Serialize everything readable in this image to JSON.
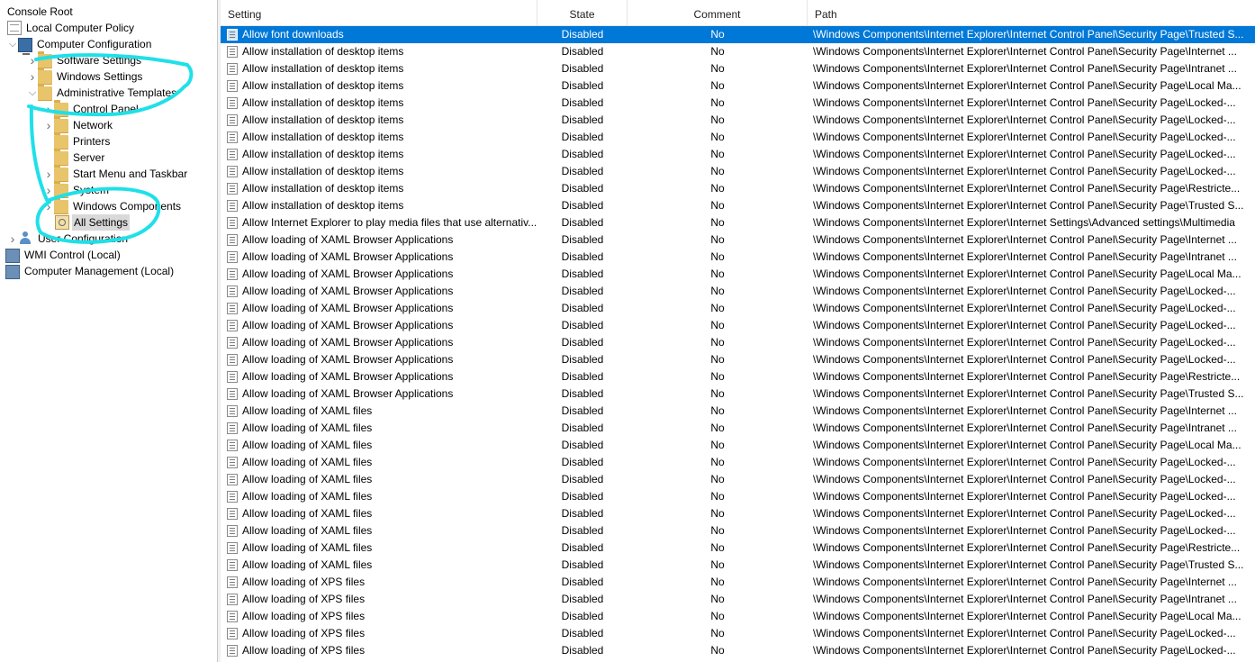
{
  "tree": {
    "items": [
      {
        "label": "Console Root",
        "indent": 0,
        "chevron": "",
        "icon": "none"
      },
      {
        "label": "Local Computer Policy",
        "indent": 0,
        "chevron": "",
        "icon": "doc"
      },
      {
        "label": "Computer Configuration",
        "indent": 1,
        "chevron": "v",
        "icon": "computer"
      },
      {
        "label": "Software Settings",
        "indent": 2,
        "chevron": ">",
        "icon": "folder"
      },
      {
        "label": "Windows Settings",
        "indent": 2,
        "chevron": ">",
        "icon": "folder"
      },
      {
        "label": "Administrative Templates",
        "indent": 2,
        "chevron": "v",
        "icon": "folder"
      },
      {
        "label": "Control Panel",
        "indent": 3,
        "chevron": ">",
        "icon": "folder"
      },
      {
        "label": "Network",
        "indent": 3,
        "chevron": ">",
        "icon": "folder"
      },
      {
        "label": "Printers",
        "indent": 3,
        "chevron": "",
        "icon": "folder"
      },
      {
        "label": "Server",
        "indent": 3,
        "chevron": "",
        "icon": "folder"
      },
      {
        "label": "Start Menu and Taskbar",
        "indent": 3,
        "chevron": ">",
        "icon": "folder"
      },
      {
        "label": "System",
        "indent": 3,
        "chevron": ">",
        "icon": "folder"
      },
      {
        "label": "Windows Components",
        "indent": 3,
        "chevron": ">",
        "icon": "folder"
      },
      {
        "label": "All Settings",
        "indent": 3,
        "chevron": "",
        "icon": "allsettings",
        "selected": true
      },
      {
        "label": "User Configuration",
        "indent": 1,
        "chevron": ">",
        "icon": "user"
      },
      {
        "label": "WMI Control (Local)",
        "indent": 0,
        "chevron": "",
        "icon": "mgmt"
      },
      {
        "label": "Computer Management (Local)",
        "indent": 0,
        "chevron": "",
        "icon": "mgmt"
      }
    ]
  },
  "list": {
    "headers": {
      "setting": "Setting",
      "state": "State",
      "comment": "Comment",
      "path": "Path",
      "sort_glyph": "^"
    },
    "rows": [
      {
        "setting": "Allow font downloads",
        "state": "Disabled",
        "comment": "No",
        "path": "\\Windows Components\\Internet Explorer\\Internet Control Panel\\Security Page\\Trusted S...",
        "selected": true
      },
      {
        "setting": "Allow installation of desktop items",
        "state": "Disabled",
        "comment": "No",
        "path": "\\Windows Components\\Internet Explorer\\Internet Control Panel\\Security Page\\Internet ..."
      },
      {
        "setting": "Allow installation of desktop items",
        "state": "Disabled",
        "comment": "No",
        "path": "\\Windows Components\\Internet Explorer\\Internet Control Panel\\Security Page\\Intranet ..."
      },
      {
        "setting": "Allow installation of desktop items",
        "state": "Disabled",
        "comment": "No",
        "path": "\\Windows Components\\Internet Explorer\\Internet Control Panel\\Security Page\\Local Ma..."
      },
      {
        "setting": "Allow installation of desktop items",
        "state": "Disabled",
        "comment": "No",
        "path": "\\Windows Components\\Internet Explorer\\Internet Control Panel\\Security Page\\Locked-..."
      },
      {
        "setting": "Allow installation of desktop items",
        "state": "Disabled",
        "comment": "No",
        "path": "\\Windows Components\\Internet Explorer\\Internet Control Panel\\Security Page\\Locked-..."
      },
      {
        "setting": "Allow installation of desktop items",
        "state": "Disabled",
        "comment": "No",
        "path": "\\Windows Components\\Internet Explorer\\Internet Control Panel\\Security Page\\Locked-..."
      },
      {
        "setting": "Allow installation of desktop items",
        "state": "Disabled",
        "comment": "No",
        "path": "\\Windows Components\\Internet Explorer\\Internet Control Panel\\Security Page\\Locked-..."
      },
      {
        "setting": "Allow installation of desktop items",
        "state": "Disabled",
        "comment": "No",
        "path": "\\Windows Components\\Internet Explorer\\Internet Control Panel\\Security Page\\Locked-..."
      },
      {
        "setting": "Allow installation of desktop items",
        "state": "Disabled",
        "comment": "No",
        "path": "\\Windows Components\\Internet Explorer\\Internet Control Panel\\Security Page\\Restricte..."
      },
      {
        "setting": "Allow installation of desktop items",
        "state": "Disabled",
        "comment": "No",
        "path": "\\Windows Components\\Internet Explorer\\Internet Control Panel\\Security Page\\Trusted S..."
      },
      {
        "setting": "Allow Internet Explorer to play media files that use alternativ...",
        "state": "Disabled",
        "comment": "No",
        "path": "\\Windows Components\\Internet Explorer\\Internet Settings\\Advanced settings\\Multimedia"
      },
      {
        "setting": "Allow loading of XAML Browser Applications",
        "state": "Disabled",
        "comment": "No",
        "path": "\\Windows Components\\Internet Explorer\\Internet Control Panel\\Security Page\\Internet ..."
      },
      {
        "setting": "Allow loading of XAML Browser Applications",
        "state": "Disabled",
        "comment": "No",
        "path": "\\Windows Components\\Internet Explorer\\Internet Control Panel\\Security Page\\Intranet ..."
      },
      {
        "setting": "Allow loading of XAML Browser Applications",
        "state": "Disabled",
        "comment": "No",
        "path": "\\Windows Components\\Internet Explorer\\Internet Control Panel\\Security Page\\Local Ma..."
      },
      {
        "setting": "Allow loading of XAML Browser Applications",
        "state": "Disabled",
        "comment": "No",
        "path": "\\Windows Components\\Internet Explorer\\Internet Control Panel\\Security Page\\Locked-..."
      },
      {
        "setting": "Allow loading of XAML Browser Applications",
        "state": "Disabled",
        "comment": "No",
        "path": "\\Windows Components\\Internet Explorer\\Internet Control Panel\\Security Page\\Locked-..."
      },
      {
        "setting": "Allow loading of XAML Browser Applications",
        "state": "Disabled",
        "comment": "No",
        "path": "\\Windows Components\\Internet Explorer\\Internet Control Panel\\Security Page\\Locked-..."
      },
      {
        "setting": "Allow loading of XAML Browser Applications",
        "state": "Disabled",
        "comment": "No",
        "path": "\\Windows Components\\Internet Explorer\\Internet Control Panel\\Security Page\\Locked-..."
      },
      {
        "setting": "Allow loading of XAML Browser Applications",
        "state": "Disabled",
        "comment": "No",
        "path": "\\Windows Components\\Internet Explorer\\Internet Control Panel\\Security Page\\Locked-..."
      },
      {
        "setting": "Allow loading of XAML Browser Applications",
        "state": "Disabled",
        "comment": "No",
        "path": "\\Windows Components\\Internet Explorer\\Internet Control Panel\\Security Page\\Restricte..."
      },
      {
        "setting": "Allow loading of XAML Browser Applications",
        "state": "Disabled",
        "comment": "No",
        "path": "\\Windows Components\\Internet Explorer\\Internet Control Panel\\Security Page\\Trusted S..."
      },
      {
        "setting": "Allow loading of XAML files",
        "state": "Disabled",
        "comment": "No",
        "path": "\\Windows Components\\Internet Explorer\\Internet Control Panel\\Security Page\\Internet ..."
      },
      {
        "setting": "Allow loading of XAML files",
        "state": "Disabled",
        "comment": "No",
        "path": "\\Windows Components\\Internet Explorer\\Internet Control Panel\\Security Page\\Intranet ..."
      },
      {
        "setting": "Allow loading of XAML files",
        "state": "Disabled",
        "comment": "No",
        "path": "\\Windows Components\\Internet Explorer\\Internet Control Panel\\Security Page\\Local Ma..."
      },
      {
        "setting": "Allow loading of XAML files",
        "state": "Disabled",
        "comment": "No",
        "path": "\\Windows Components\\Internet Explorer\\Internet Control Panel\\Security Page\\Locked-..."
      },
      {
        "setting": "Allow loading of XAML files",
        "state": "Disabled",
        "comment": "No",
        "path": "\\Windows Components\\Internet Explorer\\Internet Control Panel\\Security Page\\Locked-..."
      },
      {
        "setting": "Allow loading of XAML files",
        "state": "Disabled",
        "comment": "No",
        "path": "\\Windows Components\\Internet Explorer\\Internet Control Panel\\Security Page\\Locked-..."
      },
      {
        "setting": "Allow loading of XAML files",
        "state": "Disabled",
        "comment": "No",
        "path": "\\Windows Components\\Internet Explorer\\Internet Control Panel\\Security Page\\Locked-..."
      },
      {
        "setting": "Allow loading of XAML files",
        "state": "Disabled",
        "comment": "No",
        "path": "\\Windows Components\\Internet Explorer\\Internet Control Panel\\Security Page\\Locked-..."
      },
      {
        "setting": "Allow loading of XAML files",
        "state": "Disabled",
        "comment": "No",
        "path": "\\Windows Components\\Internet Explorer\\Internet Control Panel\\Security Page\\Restricte..."
      },
      {
        "setting": "Allow loading of XAML files",
        "state": "Disabled",
        "comment": "No",
        "path": "\\Windows Components\\Internet Explorer\\Internet Control Panel\\Security Page\\Trusted S..."
      },
      {
        "setting": "Allow loading of XPS files",
        "state": "Disabled",
        "comment": "No",
        "path": "\\Windows Components\\Internet Explorer\\Internet Control Panel\\Security Page\\Internet ..."
      },
      {
        "setting": "Allow loading of XPS files",
        "state": "Disabled",
        "comment": "No",
        "path": "\\Windows Components\\Internet Explorer\\Internet Control Panel\\Security Page\\Intranet ..."
      },
      {
        "setting": "Allow loading of XPS files",
        "state": "Disabled",
        "comment": "No",
        "path": "\\Windows Components\\Internet Explorer\\Internet Control Panel\\Security Page\\Local Ma..."
      },
      {
        "setting": "Allow loading of XPS files",
        "state": "Disabled",
        "comment": "No",
        "path": "\\Windows Components\\Internet Explorer\\Internet Control Panel\\Security Page\\Locked-..."
      },
      {
        "setting": "Allow loading of XPS files",
        "state": "Disabled",
        "comment": "No",
        "path": "\\Windows Components\\Internet Explorer\\Internet Control Panel\\Security Page\\Locked-..."
      }
    ]
  },
  "colors": {
    "selection": "#0078d7",
    "annotation": "#1fe0e8",
    "folder": "#e8c46a"
  },
  "icons": {
    "row_setting": "policy-setting-icon",
    "folder": "folder-icon",
    "chevron_expanded": "chevron-down-icon",
    "chevron_collapsed": "chevron-right-icon"
  }
}
